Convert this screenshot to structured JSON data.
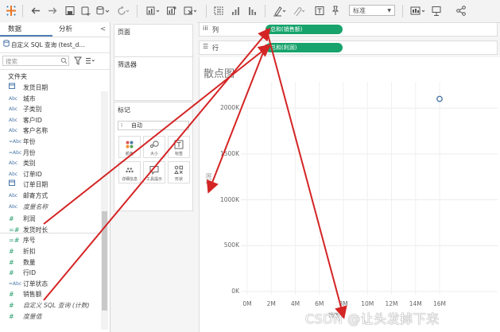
{
  "toolbar": {
    "icons": [
      "tableau-logo-icon",
      "undo-icon",
      "redo-icon",
      "save-icon",
      "new-datasource-icon",
      "datasource-icon",
      "refresh-icon",
      "new-sheet-icon",
      "duplicate-sheet-icon",
      "clear-sheet-icon",
      "swap-icon",
      "sort-asc-icon",
      "sort-desc-icon",
      "highlight-icon",
      "attachment-icon",
      "text-label-icon",
      "pin-icon",
      "show-me-icon",
      "presentation-icon",
      "share-icon"
    ],
    "fit_select": "标准"
  },
  "data_pane": {
    "tabs": [
      "数据",
      "分析"
    ],
    "collapse_glyph": "<",
    "datasource": "自定义 SQL 查询 (test_d...",
    "search_placeholder": "搜索",
    "folder_label": "文件夹",
    "fields": [
      {
        "icon": "calendar",
        "type": "",
        "label": "发货日期",
        "italic": false
      },
      {
        "icon": "abc",
        "type": "Abc",
        "label": "城市",
        "italic": false
      },
      {
        "icon": "abc",
        "type": "Abc",
        "label": "子类别",
        "italic": false
      },
      {
        "icon": "abc",
        "type": "Abc",
        "label": "客户ID",
        "italic": false
      },
      {
        "icon": "abc",
        "type": "Abc",
        "label": "客户名称",
        "italic": false
      },
      {
        "icon": "abc",
        "type": "=Abc",
        "label": "年份",
        "italic": false
      },
      {
        "icon": "abc",
        "type": "=Abc",
        "label": "月份",
        "italic": false
      },
      {
        "icon": "abc",
        "type": "Abc",
        "label": "类别",
        "italic": false
      },
      {
        "icon": "abc",
        "type": "Abc",
        "label": "订单ID",
        "italic": false
      },
      {
        "icon": "calendar",
        "type": "",
        "label": "订单日期",
        "italic": false
      },
      {
        "icon": "abc",
        "type": "Abc",
        "label": "邮寄方式",
        "italic": false
      },
      {
        "icon": "abc",
        "type": "Abc",
        "label": "度量名称",
        "italic": true
      },
      {
        "icon": "num",
        "type": "#",
        "label": "利润",
        "italic": false
      },
      {
        "icon": "num",
        "type": "=#",
        "label": "发货时长",
        "italic": false
      },
      {
        "icon": "num",
        "type": "=#",
        "label": "序号",
        "italic": false
      },
      {
        "icon": "num",
        "type": "#",
        "label": "折扣",
        "italic": false
      },
      {
        "icon": "num",
        "type": "#",
        "label": "数量",
        "italic": false
      },
      {
        "icon": "num",
        "type": "#",
        "label": "行ID",
        "italic": false
      },
      {
        "icon": "abc",
        "type": "=Abc",
        "label": "订单状态",
        "italic": false
      },
      {
        "icon": "num",
        "type": "#",
        "label": "销售额",
        "italic": false
      },
      {
        "icon": "num",
        "type": "#",
        "label": "自定义 SQL 查询 (计数)",
        "italic": true
      },
      {
        "icon": "num",
        "type": "#",
        "label": "度量值",
        "italic": true
      }
    ]
  },
  "cards": {
    "pages": "页面",
    "filters": "筛选器",
    "marks": "标记",
    "mark_type": "自动",
    "mark_buttons": [
      {
        "label": "颜色",
        "icon": "color-icon"
      },
      {
        "label": "大小",
        "icon": "size-icon"
      },
      {
        "label": "标签",
        "icon": "label-icon"
      },
      {
        "label": "详细信息",
        "icon": "detail-icon"
      },
      {
        "label": "工具提示",
        "icon": "tooltip-icon"
      },
      {
        "label": "形状",
        "icon": "shape-icon"
      }
    ]
  },
  "shelves": {
    "columns_label": "列",
    "columns_pill": "总和(销售额)",
    "rows_label": "行",
    "rows_pill": "总和(利润)"
  },
  "view": {
    "title": "散点图",
    "watermark": "CSDN @让头发掉下来"
  },
  "chart_data": {
    "type": "scatter",
    "title": "散点图",
    "xlabel": "销售额",
    "ylabel": "利润",
    "x_ticks": [
      "0M",
      "2M",
      "4M",
      "6M",
      "8M",
      "10M",
      "12M",
      "14M",
      "16M"
    ],
    "y_ticks": [
      "0K",
      "500K",
      "1000K",
      "1500K",
      "2000K"
    ],
    "xlim": [
      0,
      16000000
    ],
    "ylim": [
      0,
      2200000
    ],
    "grid": true,
    "mark_color": "#4e79a7",
    "points": [
      {
        "x": 16000000,
        "y": 2100000
      }
    ]
  },
  "colors": {
    "pill": "#17a36b",
    "arrow": "#d42424",
    "mark": "#4e79a7"
  }
}
